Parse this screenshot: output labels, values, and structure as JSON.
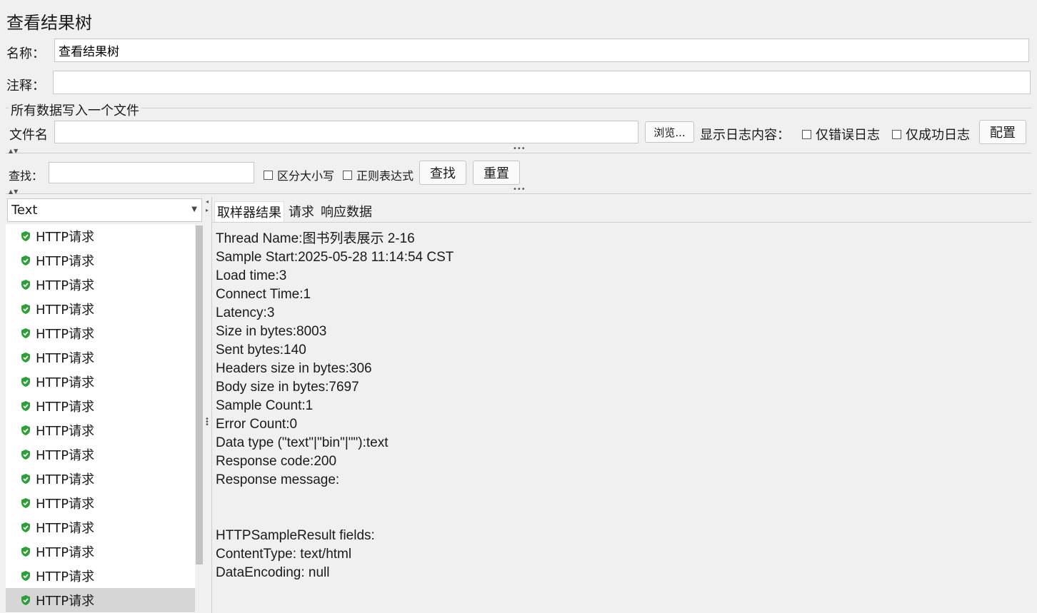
{
  "window": {
    "title": "查看结果树"
  },
  "form": {
    "name_label": "名称：",
    "name_value": "查看结果树",
    "comment_label": "注释：",
    "comment_value": "",
    "file_section_title": "所有数据写入一个文件",
    "filename_label": "文件名",
    "filename_value": "",
    "browse_button": "浏览...",
    "log_content_label": "显示日志内容：",
    "errors_only_label": "仅错误日志",
    "success_only_label": "仅成功日志",
    "config_button": "配置"
  },
  "search": {
    "label": "查找：",
    "value": "",
    "case_sensitive_label": "区分大小写",
    "regex_label": "正则表达式",
    "find_button": "查找",
    "reset_button": "重置"
  },
  "renderer": {
    "selected": "Text"
  },
  "tree": {
    "items": [
      {
        "label": "HTTP请求"
      },
      {
        "label": "HTTP请求"
      },
      {
        "label": "HTTP请求"
      },
      {
        "label": "HTTP请求"
      },
      {
        "label": "HTTP请求"
      },
      {
        "label": "HTTP请求"
      },
      {
        "label": "HTTP请求"
      },
      {
        "label": "HTTP请求"
      },
      {
        "label": "HTTP请求"
      },
      {
        "label": "HTTP请求"
      },
      {
        "label": "HTTP请求"
      },
      {
        "label": "HTTP请求"
      },
      {
        "label": "HTTP请求"
      },
      {
        "label": "HTTP请求"
      },
      {
        "label": "HTTP请求"
      },
      {
        "label": "HTTP请求",
        "selected": true
      }
    ],
    "status_icon": "green-shield-check-icon",
    "status_color": "#2e9e3a"
  },
  "tabs": [
    {
      "label": "取样器结果",
      "active": true
    },
    {
      "label": "请求"
    },
    {
      "label": "响应数据"
    }
  ],
  "result_lines": [
    "Thread Name:图书列表展示 2-16",
    "Sample Start:2025-05-28 11:14:54 CST",
    "Load time:3",
    "Connect Time:1",
    "Latency:3",
    "Size in bytes:8003",
    "Sent bytes:140",
    "Headers size in bytes:306",
    "Body size in bytes:7697",
    "Sample Count:1",
    "Error Count:0",
    "Data type (\"text\"|\"bin\"|\"\"):text",
    "Response code:200",
    "Response message:",
    "",
    "",
    "HTTPSampleResult fields:",
    "ContentType: text/html",
    "DataEncoding: null"
  ]
}
